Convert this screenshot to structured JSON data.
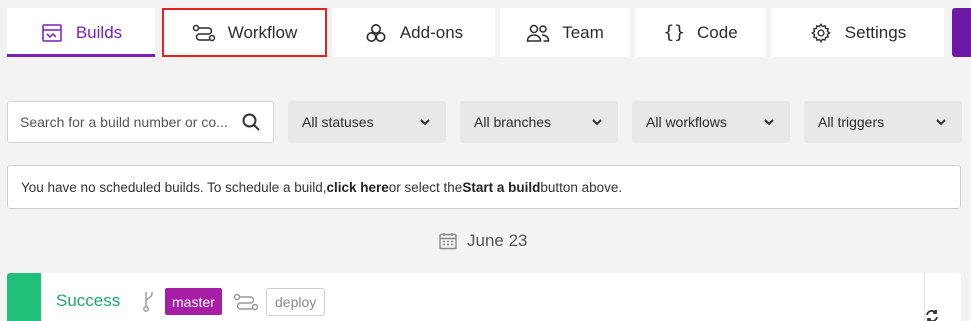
{
  "tabs": {
    "builds": "Builds",
    "workflow": "Workflow",
    "addons": "Add-ons",
    "team": "Team",
    "code": "Code",
    "settings": "Settings",
    "code_icon_glyph": "{}"
  },
  "filters": {
    "search_placeholder": "Search for a build number or co...",
    "status": "All statuses",
    "branch": "All branches",
    "workflow": "All workflows",
    "trigger": "All triggers"
  },
  "notice": {
    "pre": "You have no scheduled builds. To schedule a build, ",
    "link": "click here",
    "mid": " or select the ",
    "start": "Start a build",
    "post": " button above."
  },
  "date_label": "June 23",
  "build": {
    "status": "Success",
    "branch": "master",
    "workflow": "deploy"
  },
  "colors": {
    "accent": "#7a1fb8",
    "success": "#21c07a",
    "branch_badge": "#a61ea6",
    "highlight_border": "#e52222"
  }
}
